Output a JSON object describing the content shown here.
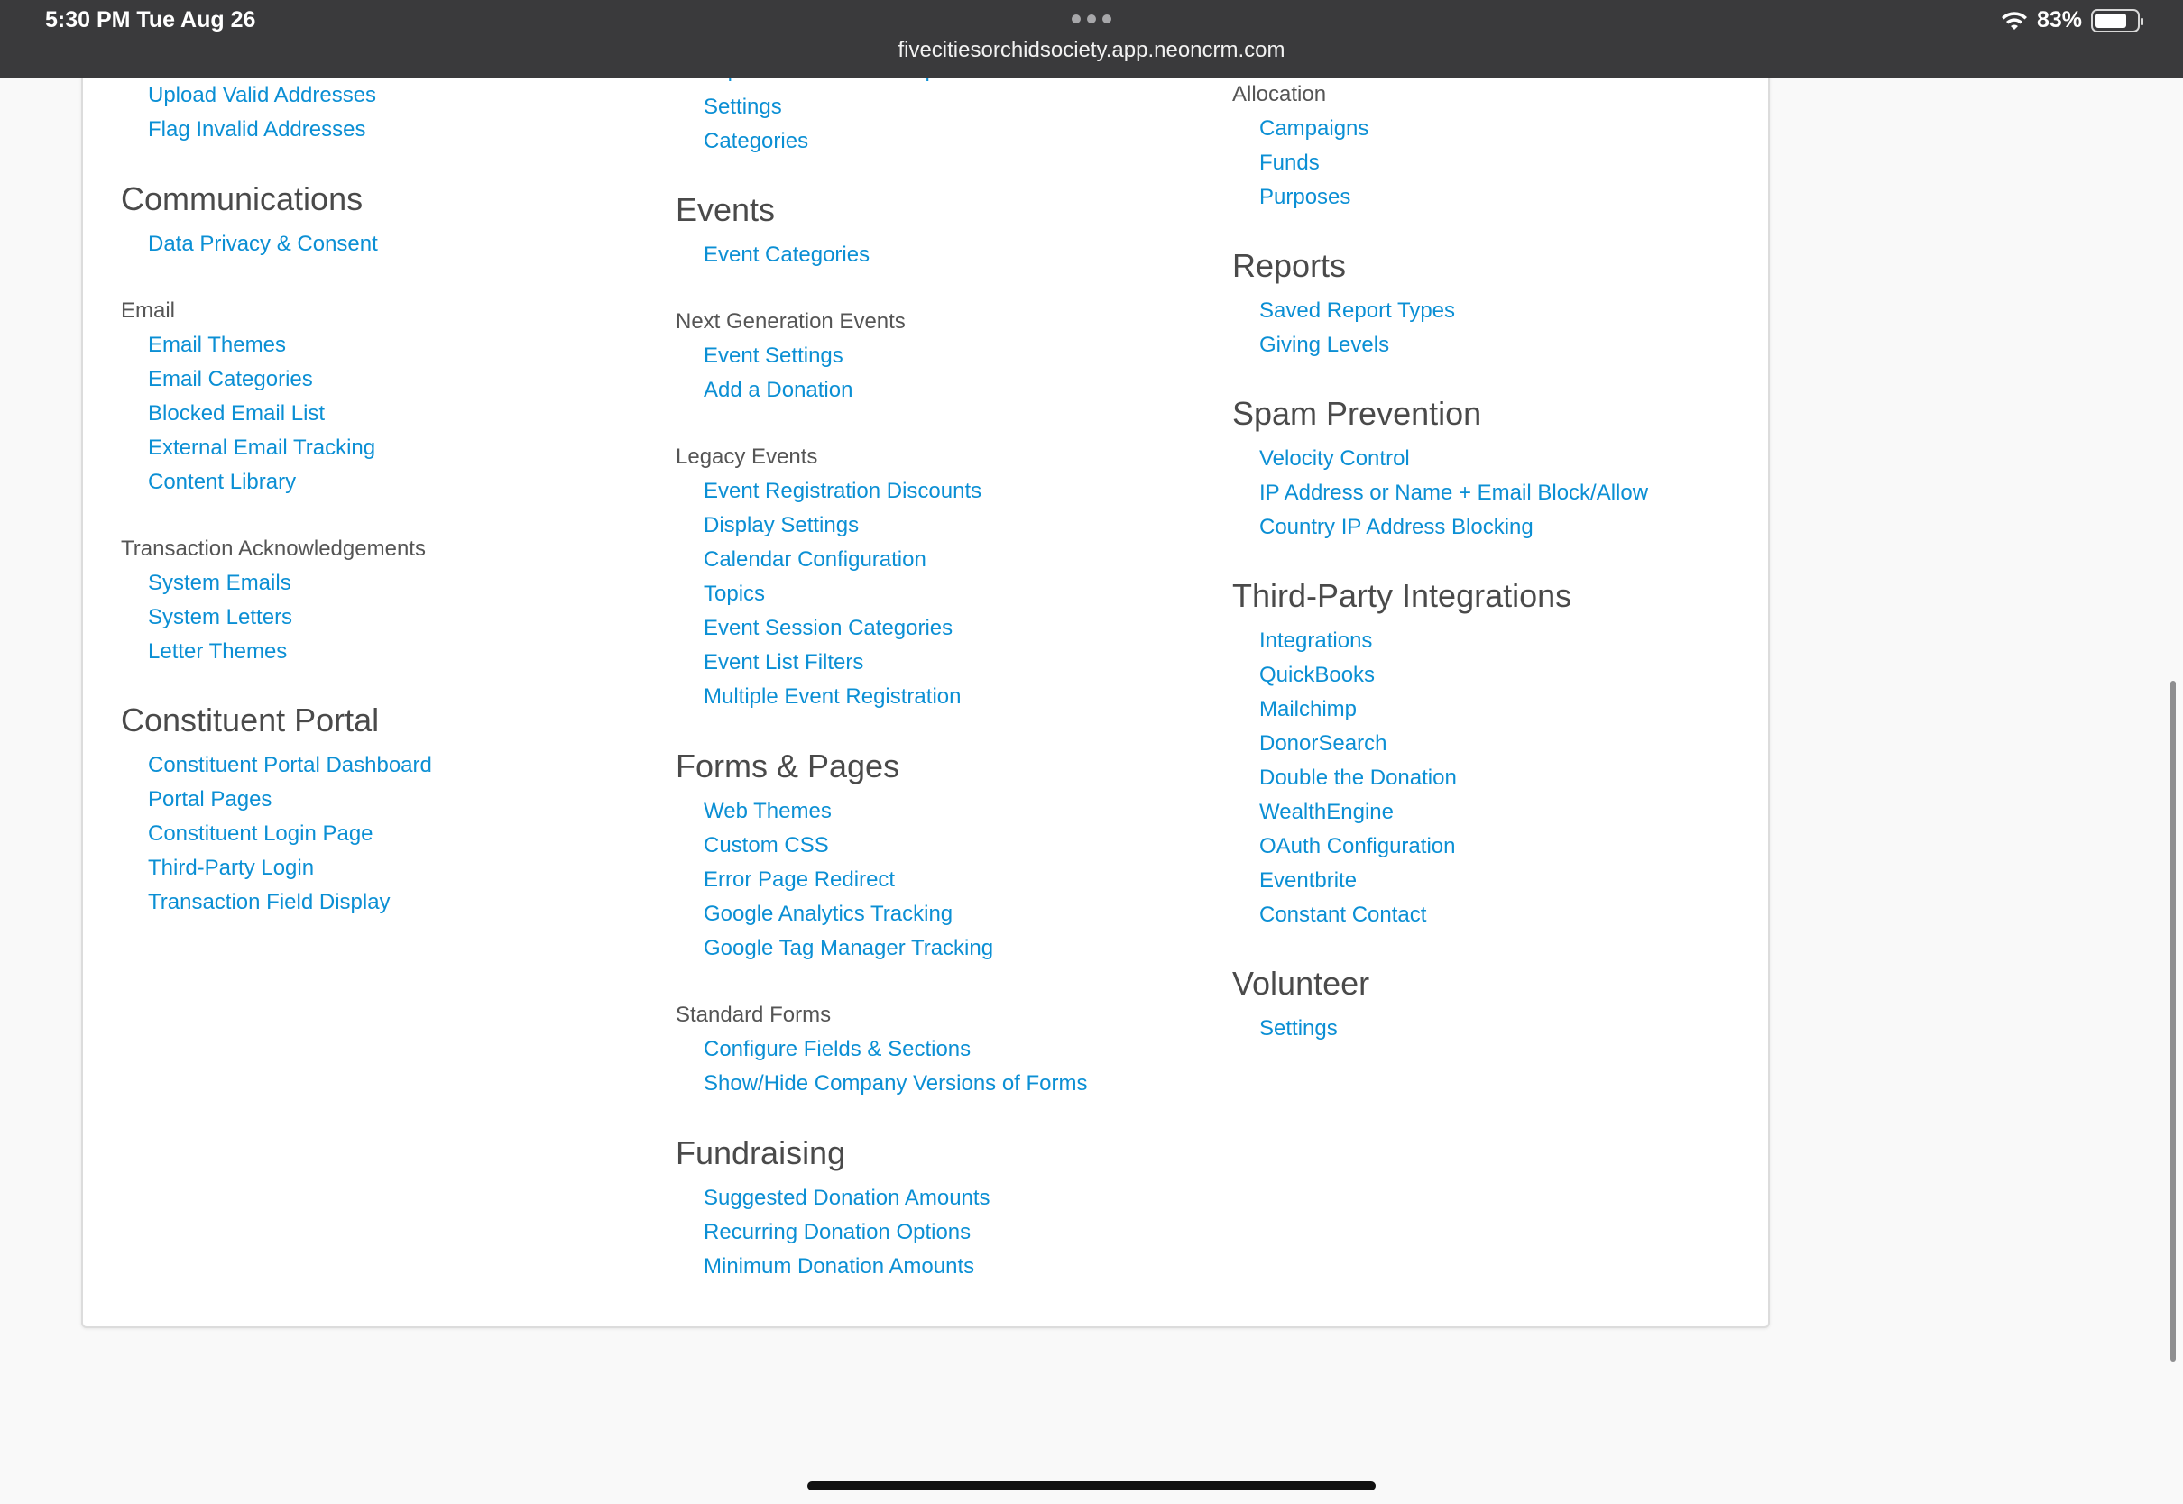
{
  "status_bar": {
    "time": "5:30 PM   Tue Aug 26",
    "url": "fivecitiesorchidsociety.app.neoncrm.com",
    "battery": "83%"
  },
  "col1": {
    "links_top": [
      "Upload Valid Addresses",
      "Flag Invalid Addresses"
    ],
    "communications": {
      "heading": "Communications",
      "link": "Data Privacy & Consent",
      "email_label": "Email",
      "email_links": [
        "Email Themes",
        "Email Categories",
        "Blocked Email List",
        "External Email Tracking",
        "Content Library"
      ],
      "ack_label": "Transaction Acknowledgements",
      "ack_links": [
        "System Emails",
        "System Letters",
        "Letter Themes"
      ]
    },
    "portal": {
      "heading": "Constituent Portal",
      "links": [
        "Constituent Portal Dashboard",
        "Portal Pages",
        "Constituent Login Page",
        "Third-Party Login",
        "Transaction Field Display"
      ]
    }
  },
  "col2": {
    "cut_link": "Implementation Data Upload",
    "links_top": [
      "Settings",
      "Categories"
    ],
    "events": {
      "heading": "Events",
      "link": "Event Categories",
      "next_label": "Next Generation Events",
      "next_links": [
        "Event Settings",
        "Add a Donation"
      ],
      "legacy_label": "Legacy Events",
      "legacy_links": [
        "Event Registration Discounts",
        "Display Settings",
        "Calendar Configuration",
        "Topics",
        "Event Session Categories",
        "Event List Filters",
        "Multiple Event Registration"
      ]
    },
    "forms": {
      "heading": "Forms & Pages",
      "links": [
        "Web Themes",
        "Custom CSS",
        "Error Page Redirect",
        "Google Analytics Tracking",
        "Google Tag Manager Tracking"
      ],
      "standard_label": "Standard Forms",
      "standard_links": [
        "Configure Fields & Sections",
        "Show/Hide Company Versions of Forms"
      ]
    },
    "fundraising": {
      "heading": "Fundraising",
      "links": [
        "Suggested Donation Amounts",
        "Recurring Donation Options",
        "Minimum Donation Amounts"
      ]
    }
  },
  "col3": {
    "allocation_label": "Allocation",
    "allocation_links": [
      "Campaigns",
      "Funds",
      "Purposes"
    ],
    "reports": {
      "heading": "Reports",
      "links": [
        "Saved Report Types",
        "Giving Levels"
      ]
    },
    "spam": {
      "heading": "Spam Prevention",
      "links": [
        "Velocity Control",
        "IP Address or Name + Email Block/Allow",
        "Country IP Address Blocking"
      ]
    },
    "integrations": {
      "heading": "Third-Party Integrations",
      "links": [
        "Integrations",
        "QuickBooks",
        "Mailchimp",
        "DonorSearch",
        "Double the Donation",
        "WealthEngine",
        "OAuth Configuration",
        "Eventbrite",
        "Constant Contact"
      ]
    },
    "volunteer": {
      "heading": "Volunteer",
      "links": [
        "Settings"
      ]
    }
  }
}
